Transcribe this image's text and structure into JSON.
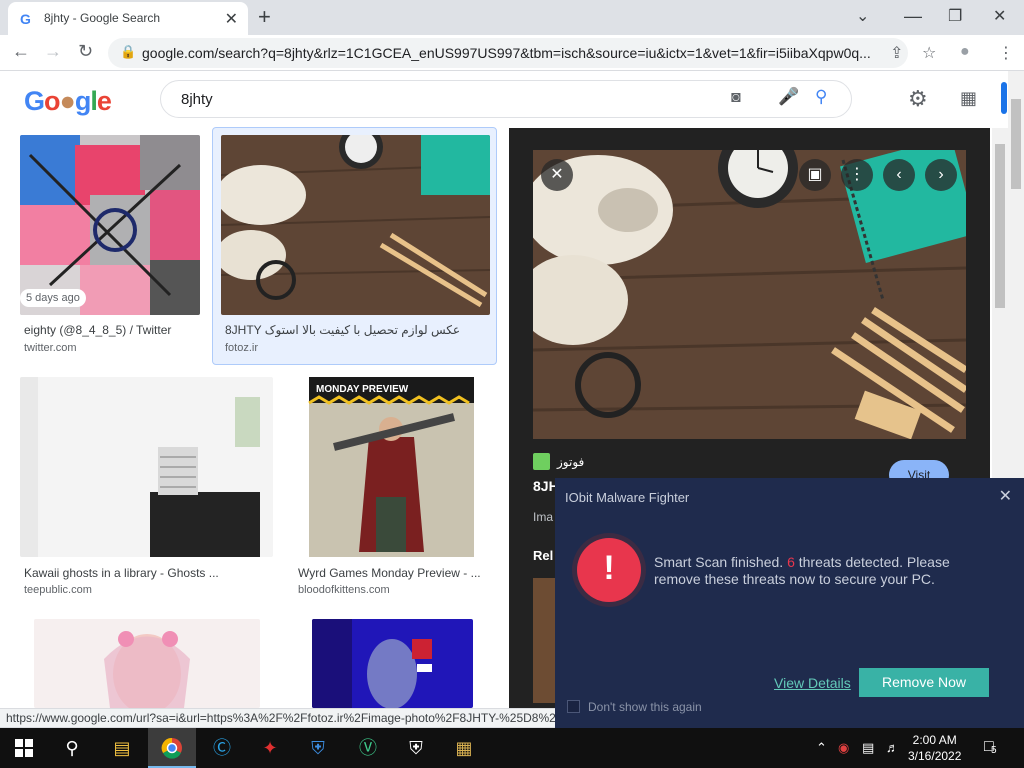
{
  "browser": {
    "tab_title": "8jhty - Google Search",
    "tab_favicon": "G",
    "url": "google.com/search?q=8jhty&rlz=1C1GCEA_enUS997US997&tbm=isch&source=iu&ictx=1&vet=1&fir=i5iibaXqpw0q...",
    "status_url": "https://www.google.com/url?sa=i&url=https%3A%2F%2Ffotoz.ir%2Fimage-photo%2F8JHTY-%25D8%25"
  },
  "google": {
    "logo": "Google",
    "query": "8jhty"
  },
  "results": [
    {
      "title": "eighty (@8_4_8_5) / Twitter",
      "source": "twitter.com",
      "badge": "5 days ago"
    },
    {
      "title": "8JHTY عکس لوازم تحصیل با کیفیت بالا استوک",
      "source": "fotoz.ir"
    },
    {
      "title": "Kawaii ghosts in a library - Ghosts ...",
      "source": "teepublic.com"
    },
    {
      "title": "Wyrd Games Monday Preview - ...",
      "source": "bloodofkittens.com",
      "image_banner": "MONDAY PREVIEW"
    }
  ],
  "preview": {
    "site": "فوتوز",
    "title": "8JH",
    "visit_label": "Visit",
    "images_label": "Ima",
    "related_label": "Rel"
  },
  "iobit": {
    "title": "IObit Malware Fighter",
    "message_before": "Smart Scan finished. ",
    "threat_count": "6",
    "message_after": " threats detected. Please remove these threats now to secure your PC.",
    "alert_symbol": "!",
    "view_details": "View Details",
    "remove_now": "Remove Now",
    "dont_show": "Don't show this again"
  },
  "taskbar": {
    "time": "2:00 AM",
    "date": "3/16/2022",
    "notification_count": "5"
  },
  "icons": {
    "close": "✕",
    "new_tab": "+",
    "minimize": "⌄",
    "restore": "❐",
    "back": "←",
    "forward": "→",
    "reload": "↻",
    "lock": "🔒",
    "share": "⇪",
    "star": "☆",
    "profile": "●",
    "menu": "⋮",
    "camera": "◙",
    "mic": "🎤",
    "search": "🔍",
    "settings": "⚙",
    "apps": "⋮⋮⋮"
  },
  "colors": {
    "accent": "#1a73e8",
    "iobit_bg": "#1f2b4d",
    "iobit_alert": "#e8364d",
    "iobit_button": "#39b2a6"
  }
}
